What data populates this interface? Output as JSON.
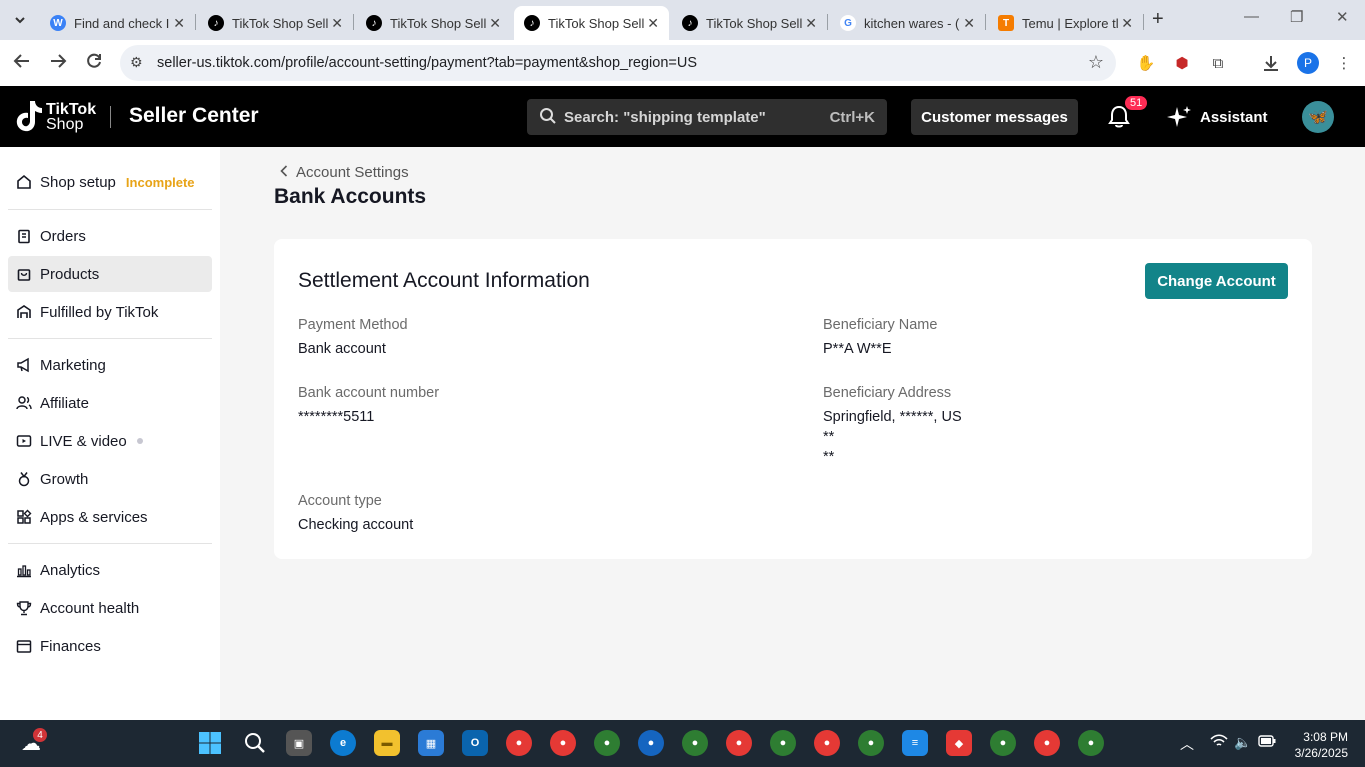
{
  "browser": {
    "tabs": [
      {
        "title": "Find and check I",
        "favicon": "w-logo",
        "color": "#3b82f6",
        "letter": "W"
      },
      {
        "title": "TikTok Shop Sell",
        "favicon": "tiktok-logo",
        "color": "#000000",
        "letter": "♪"
      },
      {
        "title": "TikTok Shop Sell",
        "favicon": "tiktok-logo",
        "color": "#000000",
        "letter": "♪"
      },
      {
        "title": "TikTok Shop Sell",
        "favicon": "tiktok-logo",
        "color": "#000000",
        "letter": "♪"
      },
      {
        "title": "TikTok Shop Sell",
        "favicon": "tiktok-logo",
        "color": "#000000",
        "letter": "♪"
      },
      {
        "title": "kitchen wares - (",
        "favicon": "google-logo",
        "color": "#4285f4",
        "letter": "G"
      },
      {
        "title": "Temu | Explore tl",
        "favicon": "temu-logo",
        "color": "#f57c00",
        "letter": "T"
      }
    ],
    "url": "seller-us.tiktok.com/profile/account-setting/payment?tab=payment&shop_region=US",
    "profile_initial": "P"
  },
  "header": {
    "logo_line1": "TikTok",
    "logo_line2": "Shop",
    "seller_center": "Seller Center",
    "search_placeholder": "Search: \"shipping template\"",
    "search_shortcut": "Ctrl+K",
    "customer_messages": "Customer messages",
    "notification_count": "51",
    "assistant": "Assistant"
  },
  "sidebar": {
    "shop_setup": "Shop setup",
    "shop_setup_status": "Incomplete",
    "items": [
      {
        "label": "Orders"
      },
      {
        "label": "Products"
      },
      {
        "label": "Fulfilled by TikTok"
      },
      {
        "label": "Marketing"
      },
      {
        "label": "Affiliate"
      },
      {
        "label": "LIVE & video"
      },
      {
        "label": "Growth"
      },
      {
        "label": "Apps & services"
      },
      {
        "label": "Analytics"
      },
      {
        "label": "Account health"
      },
      {
        "label": "Finances"
      }
    ]
  },
  "main": {
    "breadcrumb": "Account Settings",
    "title": "Bank Accounts",
    "card_title": "Settlement Account Information",
    "change_button": "Change Account",
    "fields": {
      "payment_method_label": "Payment Method",
      "payment_method_value": "Bank account",
      "beneficiary_name_label": "Beneficiary Name",
      "beneficiary_name_value": "P**A W**E",
      "bank_account_label": "Bank account number",
      "bank_account_value": "********5511",
      "beneficiary_address_label": "Beneficiary Address",
      "beneficiary_address_line1": "Springfield, ******, US",
      "beneficiary_address_line2": "**",
      "beneficiary_address_line3": "**",
      "account_type_label": "Account type",
      "account_type_value": "Checking account"
    }
  },
  "taskbar": {
    "weather_badge": "4",
    "time": "3:08 PM",
    "date": "3/26/2025"
  }
}
